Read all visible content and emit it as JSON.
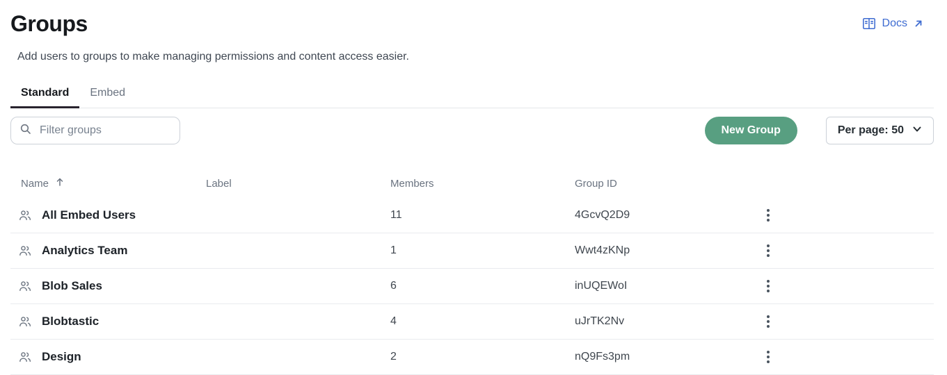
{
  "header": {
    "title": "Groups",
    "subtitle": "Add users to groups to make managing permissions and content access easier.",
    "docs_label": "Docs"
  },
  "tabs": [
    {
      "label": "Standard",
      "active": true
    },
    {
      "label": "Embed",
      "active": false
    }
  ],
  "toolbar": {
    "filter_placeholder": "Filter groups",
    "new_group_label": "New Group",
    "per_page_label": "Per page: 50"
  },
  "table": {
    "columns": [
      "Name",
      "Label",
      "Members",
      "Group ID"
    ],
    "rows": [
      {
        "name": "All Embed Users",
        "label": "",
        "members": "11",
        "group_id": "4GcvQ2D9"
      },
      {
        "name": "Analytics Team",
        "label": "",
        "members": "1",
        "group_id": "Wwt4zKNp"
      },
      {
        "name": "Blob Sales",
        "label": "",
        "members": "6",
        "group_id": "inUQEWoI"
      },
      {
        "name": "Blobtastic",
        "label": "",
        "members": "4",
        "group_id": "uJrTK2Nv"
      },
      {
        "name": "Design",
        "label": "",
        "members": "2",
        "group_id": "nQ9Fs3pm"
      }
    ]
  },
  "colors": {
    "link_blue": "#3d6bd1",
    "accent_green": "#589f81",
    "tab_underline": "#28232e"
  }
}
